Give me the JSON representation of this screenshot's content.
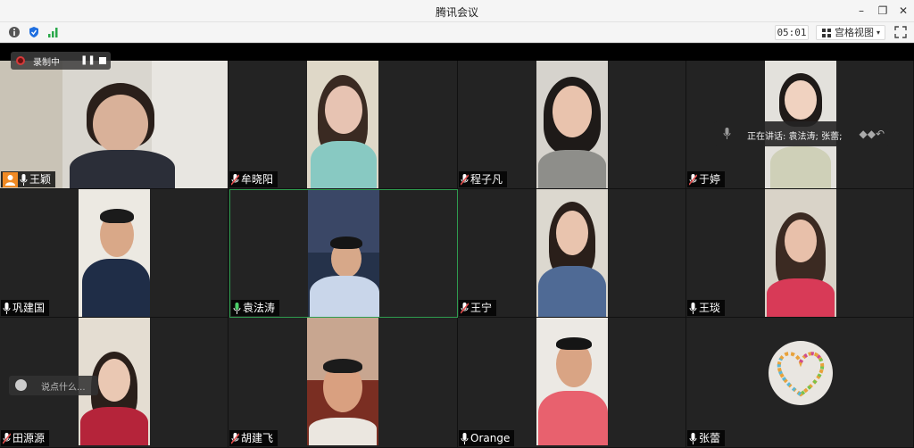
{
  "window": {
    "title": "腾讯会议",
    "minimize": "–",
    "restore": "❐",
    "close": "✕"
  },
  "toolbar": {
    "info_icon": "info-icon",
    "shield_icon": "shield-icon",
    "signal_icon": "signal-icon",
    "timer": "05:01",
    "view_label": "宫格视图",
    "view_caret": "▾",
    "fullscreen_icon": "fullscreen-icon"
  },
  "recording": {
    "label": "录制中",
    "pause": "❚❚"
  },
  "speaking": {
    "text": "正在讲话: 袁法涛; 张蕾;"
  },
  "chat": {
    "placeholder": "说点什么..."
  },
  "participants": [
    {
      "name": "王颖",
      "mic": "on",
      "host": true
    },
    {
      "name": "牟晓阳",
      "mic": "muted"
    },
    {
      "name": "程子凡",
      "mic": "muted"
    },
    {
      "name": "于婷",
      "mic": "muted"
    },
    {
      "name": "巩建国",
      "mic": "on"
    },
    {
      "name": "袁法涛",
      "mic": "on",
      "active": true
    },
    {
      "name": "王宁",
      "mic": "muted"
    },
    {
      "name": "王琰",
      "mic": "on"
    },
    {
      "name": "田源源",
      "mic": "muted"
    },
    {
      "name": "胡建飞",
      "mic": "muted"
    },
    {
      "name": "Orange",
      "mic": "on"
    },
    {
      "name": "张蕾",
      "mic": "on",
      "avatar": true
    }
  ],
  "colors": {
    "active_border": "#2f9c4f",
    "muted_mic": "#e24b4b",
    "host_badge": "#f08a24"
  }
}
